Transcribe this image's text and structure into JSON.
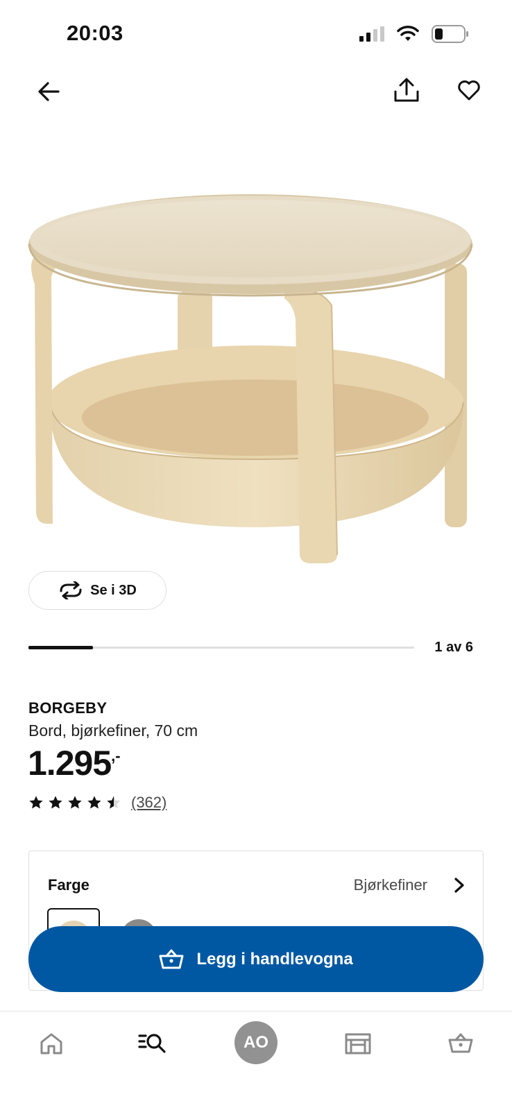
{
  "status_bar": {
    "time": "20:03"
  },
  "nav": {
    "back_icon": "arrow-left-icon",
    "share_icon": "share-icon",
    "favorite_icon": "heart-icon"
  },
  "view_3d": {
    "label": "Se i 3D",
    "icon": "rotate-3d-icon"
  },
  "gallery": {
    "position_text": "1 av 6",
    "current": 1,
    "total": 6
  },
  "product": {
    "name": "BORGEBY",
    "description": "Bord, bjørkefiner, 70 cm",
    "price": "1.295",
    "price_suffix": ",-",
    "rating": 4.5,
    "review_count": "(362)"
  },
  "color": {
    "label": "Farge",
    "value": "Bjørkefiner",
    "swatches": [
      "Bjørkefiner",
      "grey"
    ]
  },
  "cart_button": {
    "label": "Legg i handlevogna",
    "icon": "basket-icon"
  },
  "tab_bar": {
    "items": [
      "home-icon",
      "search-icon",
      "avatar",
      "store-icon",
      "basket-icon"
    ],
    "avatar_initials": "AO"
  },
  "colors": {
    "primary_blue": "#0058a3",
    "avatar_grey": "#929292"
  }
}
